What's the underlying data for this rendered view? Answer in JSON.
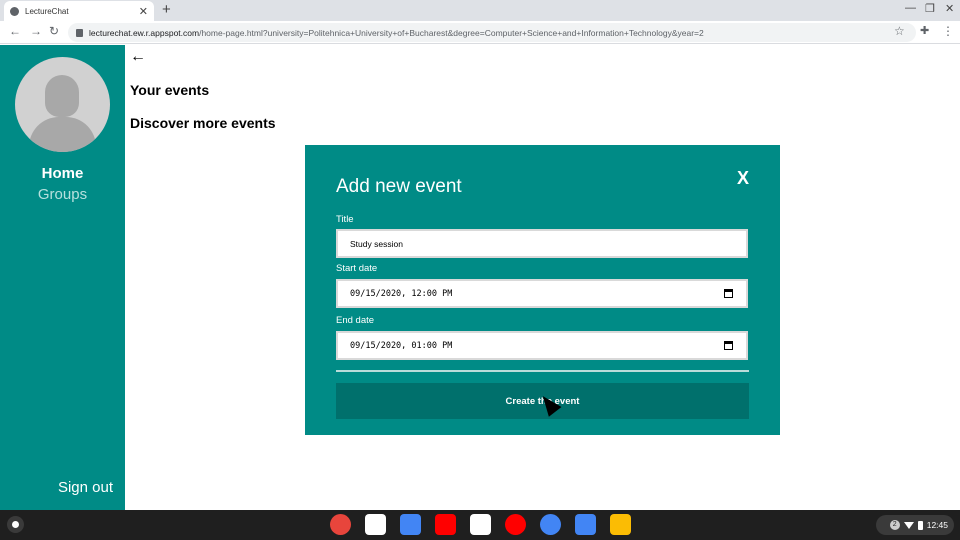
{
  "browser": {
    "tab_title": "LectureChat",
    "tab_close": "✕",
    "new_tab": "+",
    "url_host": "lecturechat.ew.r.appspot.com",
    "url_path": "/home-page.html?university=Politehnica+University+of+Bucharest&degree=Computer+Science+and+Information+Technology&year=2",
    "back": "←",
    "forward": "→",
    "reload": "↻",
    "minimize": "—",
    "restore": "❐",
    "close": "✕",
    "star": "☆",
    "extensions": "✚",
    "menu": "⋮"
  },
  "sidebar": {
    "home": "Home",
    "groups": "Groups",
    "sign_out": "Sign out"
  },
  "main": {
    "back_arrow": "←",
    "your_events": "Your events",
    "discover_events": "Discover more events"
  },
  "modal": {
    "title": "Add new event",
    "close": "X",
    "title_label": "Title",
    "title_value": "Study session",
    "start_label": "Start date",
    "start_value": "09/15/2020, 12:00 PM",
    "end_label": "End date",
    "end_value": "09/15/2020, 01:00 PM",
    "create_button": "Create the event"
  },
  "taskbar": {
    "apps": [
      {
        "name": "chrome-icon",
        "color": "#e8453c"
      },
      {
        "name": "gmail-icon",
        "color": "#ffffff"
      },
      {
        "name": "docs-icon",
        "color": "#4285f4"
      },
      {
        "name": "youtube-icon",
        "color": "#ff0000"
      },
      {
        "name": "play-store-icon",
        "color": "#ffffff"
      },
      {
        "name": "youtube-music-icon",
        "color": "#ff0000"
      },
      {
        "name": "settings-icon",
        "color": "#4285f4"
      },
      {
        "name": "files-icon",
        "color": "#4285f4"
      },
      {
        "name": "keep-icon",
        "color": "#fbbc04"
      }
    ],
    "notification_count": "2",
    "time": "12:45"
  },
  "colors": {
    "teal": "#008b86",
    "teal_dark": "#00706c"
  }
}
